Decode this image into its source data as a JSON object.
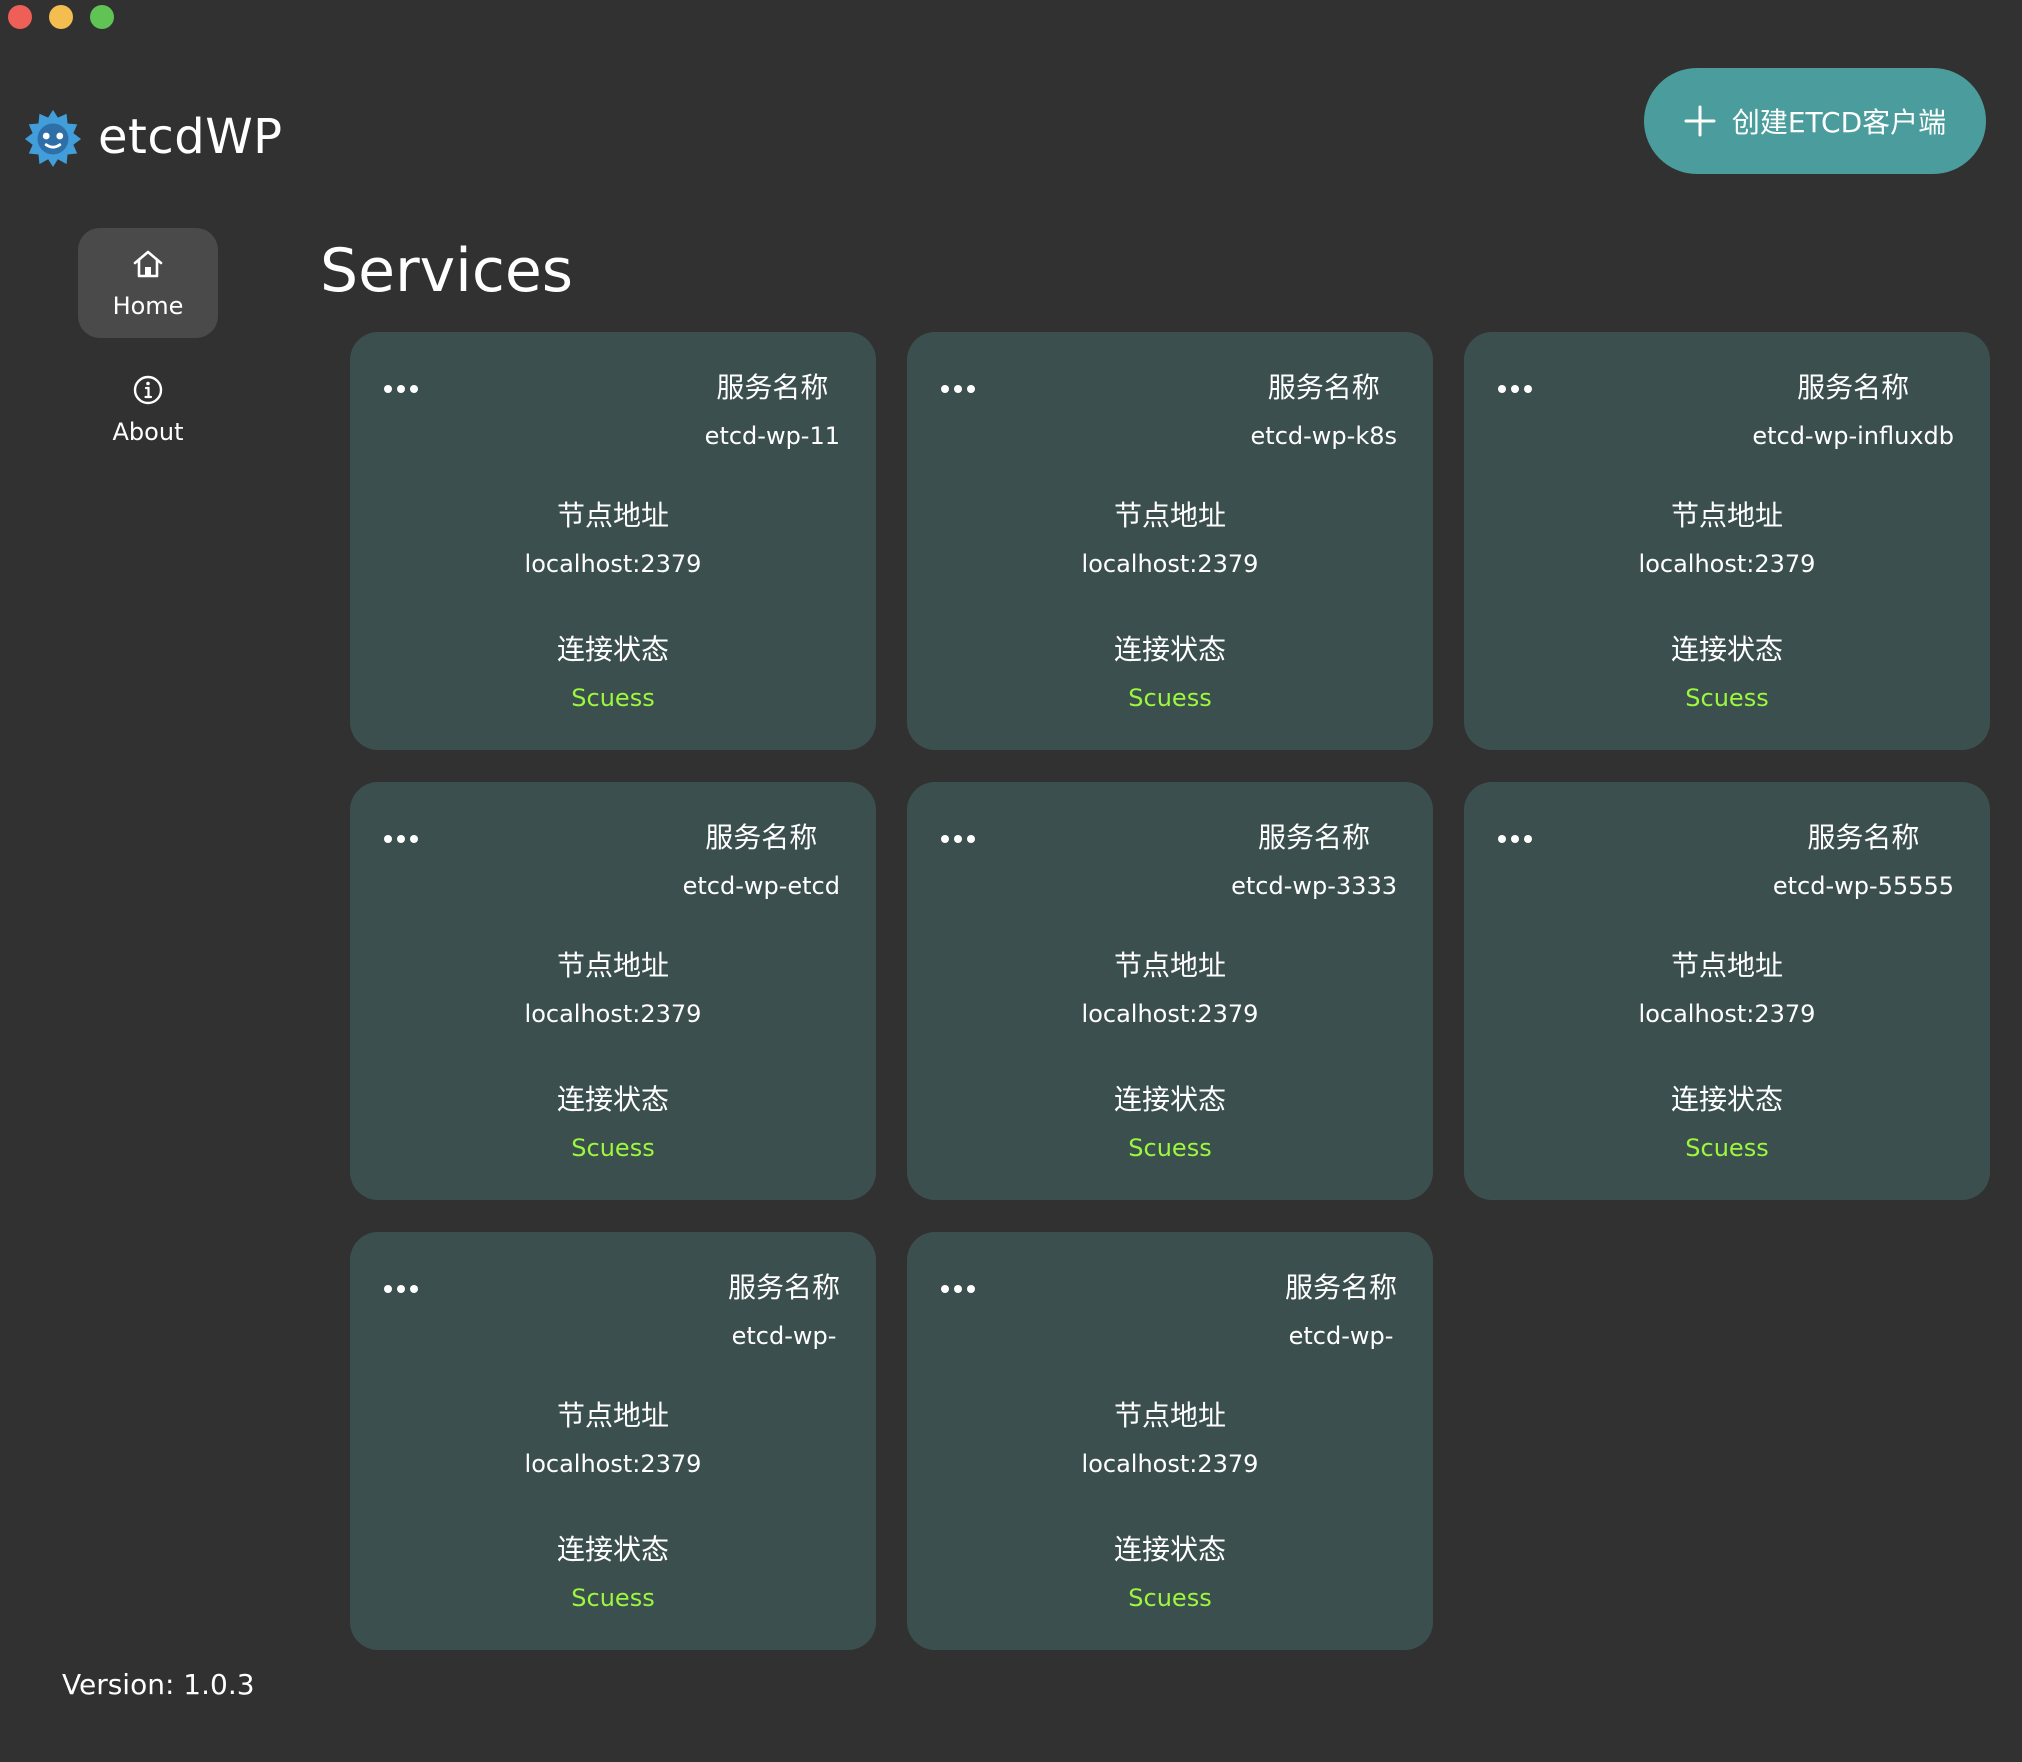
{
  "app": {
    "name": "etcdWP",
    "version": "Version: 1.0.3"
  },
  "nav": {
    "items": [
      {
        "label": "Home",
        "icon": "home-icon",
        "active": true
      },
      {
        "label": "About",
        "icon": "info-icon",
        "active": false
      }
    ]
  },
  "header": {
    "create_button_label": "创建ETCD客户端",
    "create_button_icon": "plus-icon",
    "accent_color": "#4b9d9d"
  },
  "main": {
    "title": "Services",
    "card_labels": {
      "service_name": "服务名称",
      "node_address": "节点地址",
      "connection_status": "连接状态"
    },
    "status_color": "#9bf83d",
    "services": [
      {
        "name": "etcd-wp-11",
        "address": "localhost:2379",
        "status": "Scuess"
      },
      {
        "name": "etcd-wp-k8s",
        "address": "localhost:2379",
        "status": "Scuess"
      },
      {
        "name": "etcd-wp-influxdb",
        "address": "localhost:2379",
        "status": "Scuess"
      },
      {
        "name": "etcd-wp-etcd",
        "address": "localhost:2379",
        "status": "Scuess"
      },
      {
        "name": "etcd-wp-3333",
        "address": "localhost:2379",
        "status": "Scuess"
      },
      {
        "name": "etcd-wp-55555",
        "address": "localhost:2379",
        "status": "Scuess"
      },
      {
        "name": "etcd-wp-",
        "address": "localhost:2379",
        "status": "Scuess"
      },
      {
        "name": "etcd-wp-",
        "address": "localhost:2379",
        "status": "Scuess"
      }
    ]
  }
}
